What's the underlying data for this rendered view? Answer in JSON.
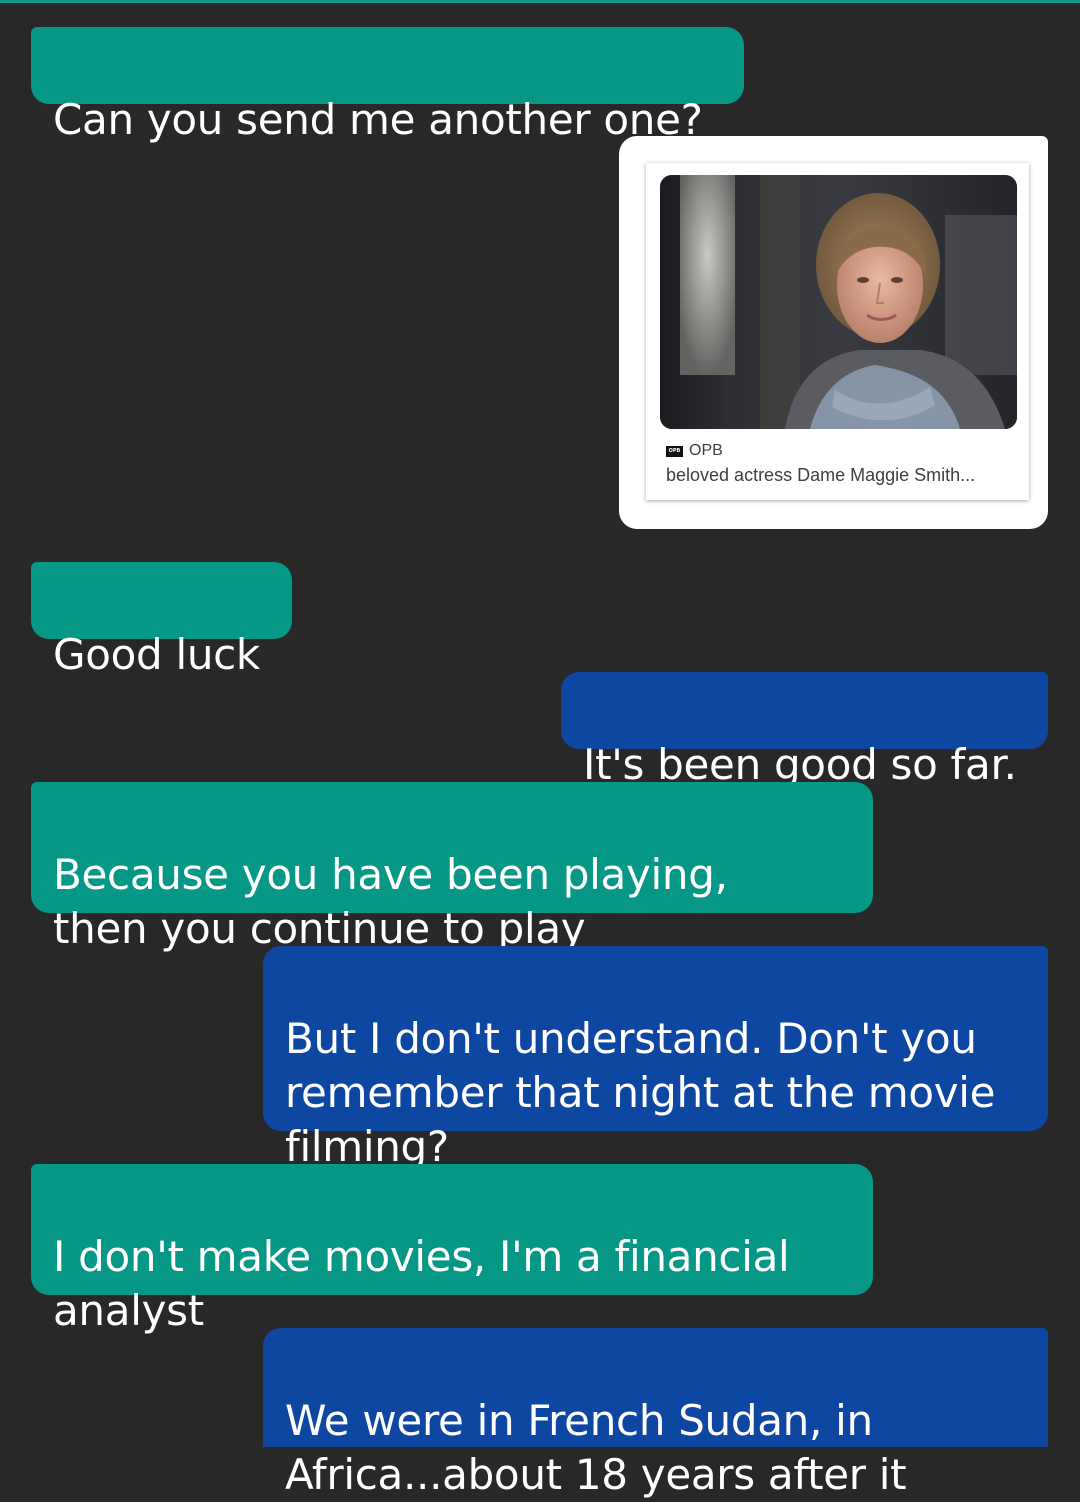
{
  "messages": [
    {
      "text": "Can you send me another one?"
    },
    {
      "source": "OPB",
      "source_logo": "OPB",
      "caption": "beloved actress Dame Maggie Smith..."
    },
    {
      "text": "Good luck"
    },
    {
      "text": "It's been good so far."
    },
    {
      "text": "Because you have been playing,\nthen you continue to play"
    },
    {
      "text": "But I don't understand.  Don't you\nremember that night at the movie\nfilming?"
    },
    {
      "text": "I don't make movies, I'm a financial\nanalyst"
    },
    {
      "text": "We were in French Sudan, in\nAfrica...about 18 years after it"
    }
  ],
  "colors": {
    "background": "#282828",
    "incoming_bubble": "#069786",
    "outgoing_bubble": "#0e47a1",
    "text": "#ffffff"
  }
}
